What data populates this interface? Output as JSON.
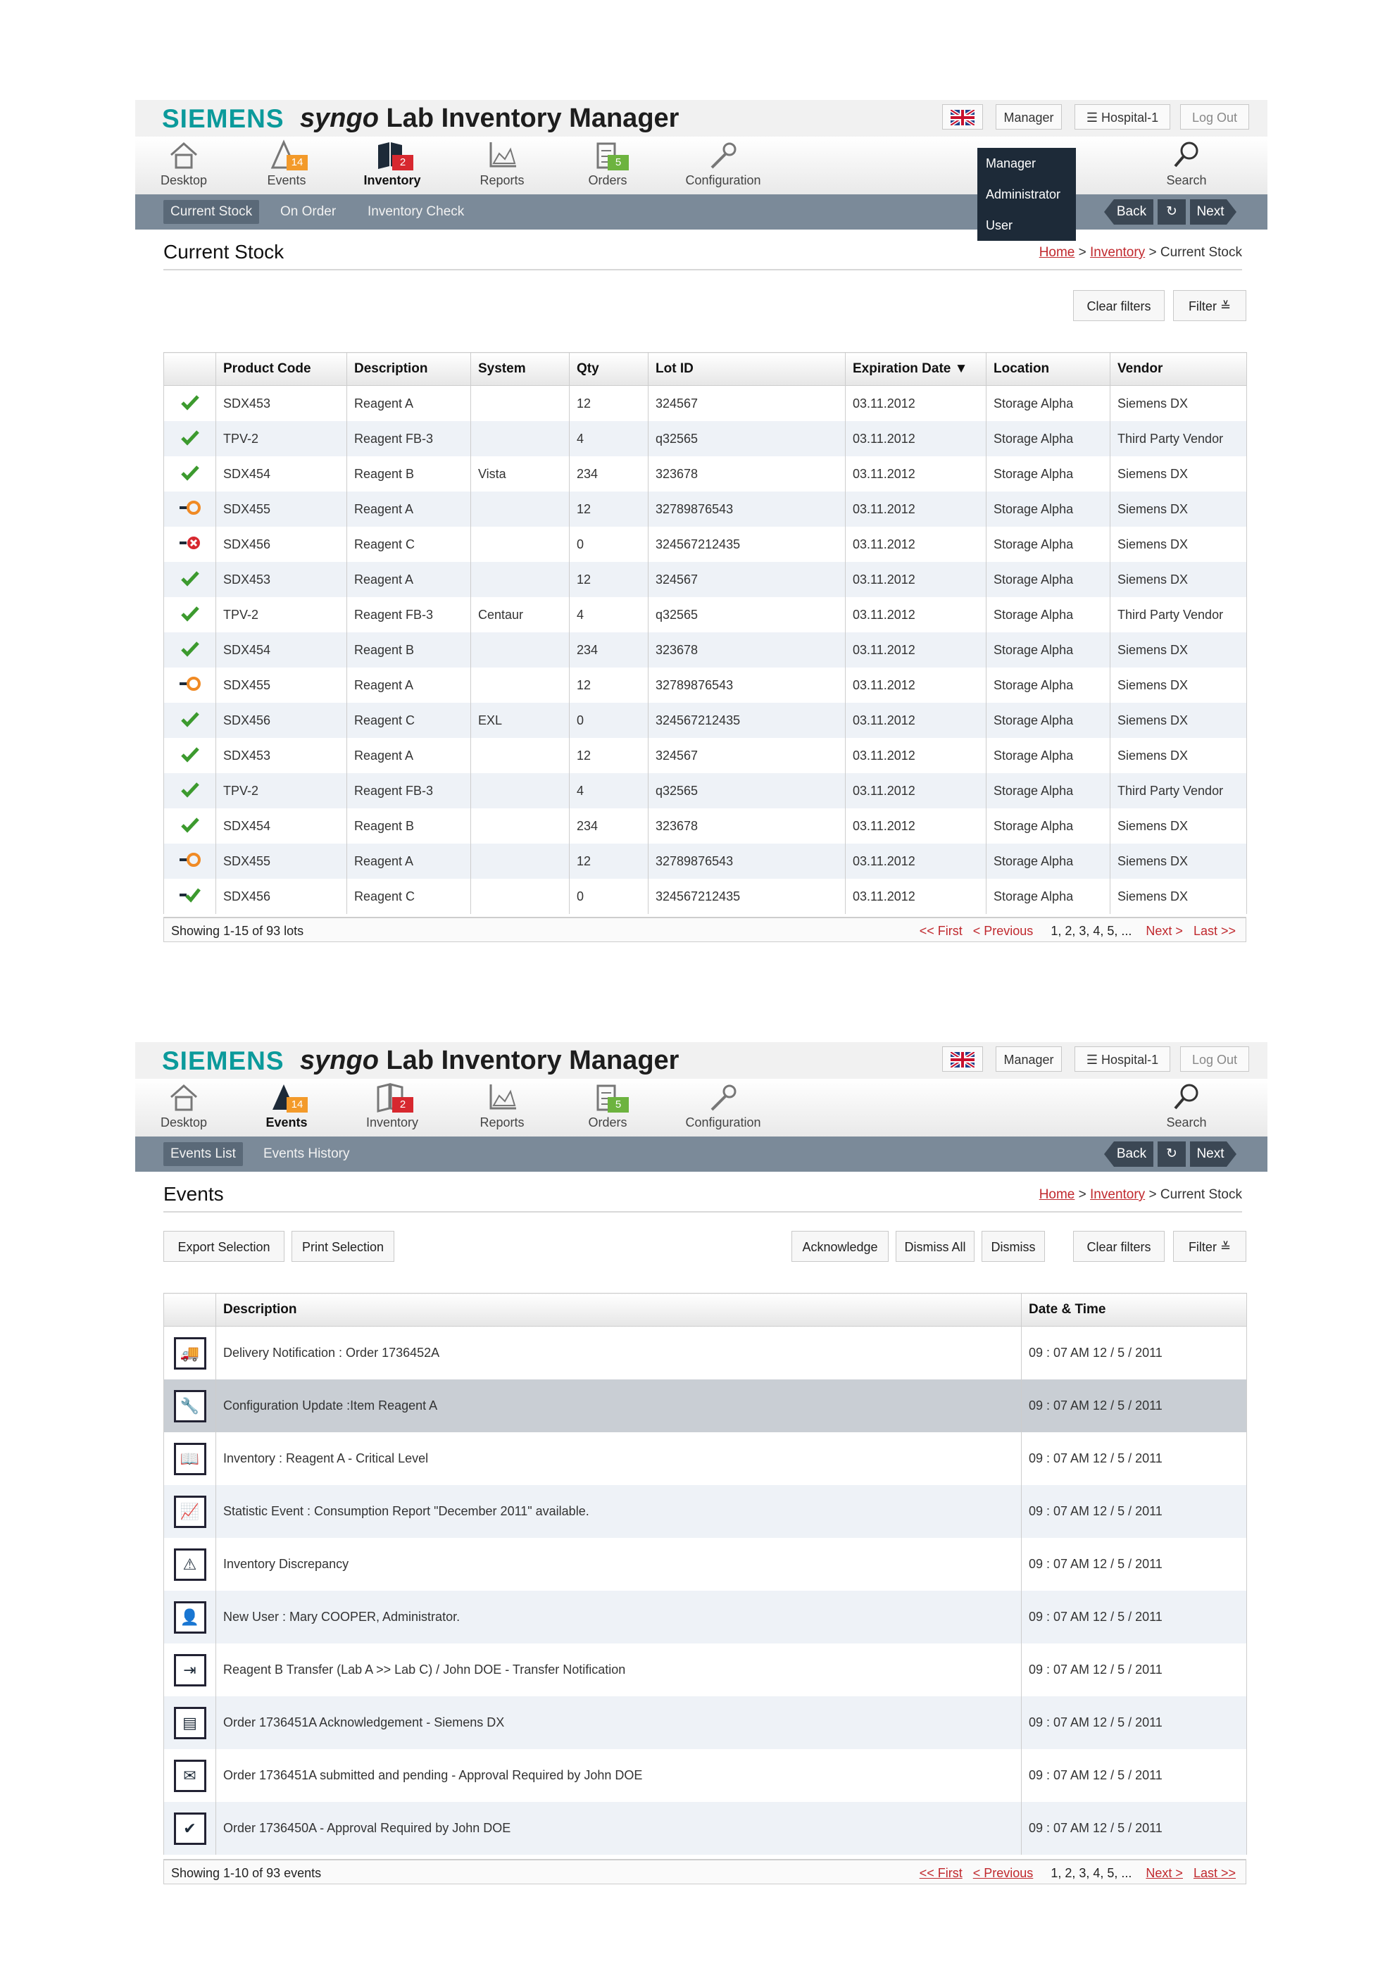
{
  "header": {
    "logo": "SIEMENS",
    "title_prefix": "syngo",
    "title_rest": "Lab Inventory Manager",
    "role_button": "Manager",
    "hospital_button": "Hospital-1",
    "logout_button": "Log Out"
  },
  "nav": {
    "desktop": "Desktop",
    "events": "Events",
    "events_badge": "14",
    "inventory": "Inventory",
    "inventory_badge": "2",
    "reports": "Reports",
    "orders": "Orders",
    "orders_badge": "5",
    "configuration": "Configuration",
    "search": "Search"
  },
  "nav_buttons": {
    "back": "Back",
    "next": "Next"
  },
  "stock_screen": {
    "subtabs": [
      "Current Stock",
      "On Order",
      "Inventory Check"
    ],
    "role_dropdown": [
      "Manager",
      "Administrator",
      "User"
    ],
    "page_title": "Current Stock",
    "breadcrumb": {
      "home": "Home",
      "sep1": " > ",
      "inventory": "Inventory",
      "sep2": " > ",
      "current": "Current Stock"
    },
    "clear_filters": "Clear filters",
    "filter": "Filter",
    "columns": [
      "Product Code",
      "Description",
      "System",
      "Qty",
      "Lot ID",
      "Expiration Date ▼",
      "Location",
      "Vendor"
    ],
    "rows": [
      {
        "status": "ok",
        "code": "SDX453",
        "desc": "Reagent A",
        "system": "",
        "qty": "12",
        "lot": "324567",
        "exp": "03.11.2012",
        "loc": "Storage Alpha",
        "vendor": "Siemens DX"
      },
      {
        "status": "ok",
        "code": "TPV-2",
        "desc": "Reagent FB-3",
        "system": "",
        "qty": "4",
        "lot": "q32565",
        "exp": "03.11.2012",
        "loc": "Storage Alpha",
        "vendor": "Third Party Vendor"
      },
      {
        "status": "ok",
        "code": "SDX454",
        "desc": "Reagent B",
        "system": "Vista",
        "qty": "234",
        "lot": "323678",
        "exp": "03.11.2012",
        "loc": "Storage Alpha",
        "vendor": "Siemens DX"
      },
      {
        "status": "transfer",
        "code": "SDX455",
        "desc": "Reagent A",
        "system": "",
        "qty": "12",
        "lot": "32789876543",
        "exp": "03.11.2012",
        "loc": "Storage Alpha",
        "vendor": "Siemens DX"
      },
      {
        "status": "error",
        "code": "SDX456",
        "desc": "Reagent C",
        "system": "",
        "qty": "0",
        "lot": "324567212435",
        "exp": "03.11.2012",
        "loc": "Storage Alpha",
        "vendor": "Siemens DX"
      },
      {
        "status": "ok",
        "code": "SDX453",
        "desc": "Reagent A",
        "system": "",
        "qty": "12",
        "lot": "324567",
        "exp": "03.11.2012",
        "loc": "Storage Alpha",
        "vendor": "Siemens DX"
      },
      {
        "status": "ok",
        "code": "TPV-2",
        "desc": "Reagent FB-3",
        "system": "Centaur",
        "qty": "4",
        "lot": "q32565",
        "exp": "03.11.2012",
        "loc": "Storage Alpha",
        "vendor": "Third Party Vendor"
      },
      {
        "status": "ok",
        "code": "SDX454",
        "desc": "Reagent B",
        "system": "",
        "qty": "234",
        "lot": "323678",
        "exp": "03.11.2012",
        "loc": "Storage Alpha",
        "vendor": "Siemens DX"
      },
      {
        "status": "transfer",
        "code": "SDX455",
        "desc": "Reagent A",
        "system": "",
        "qty": "12",
        "lot": "32789876543",
        "exp": "03.11.2012",
        "loc": "Storage Alpha",
        "vendor": "Siemens DX"
      },
      {
        "status": "ok",
        "code": "SDX456",
        "desc": "Reagent C",
        "system": "EXL",
        "qty": "0",
        "lot": "324567212435",
        "exp": "03.11.2012",
        "loc": "Storage Alpha",
        "vendor": "Siemens DX"
      },
      {
        "status": "ok",
        "code": "SDX453",
        "desc": "Reagent A",
        "system": "",
        "qty": "12",
        "lot": "324567",
        "exp": "03.11.2012",
        "loc": "Storage Alpha",
        "vendor": "Siemens DX"
      },
      {
        "status": "ok",
        "code": "TPV-2",
        "desc": "Reagent FB-3",
        "system": "",
        "qty": "4",
        "lot": "q32565",
        "exp": "03.11.2012",
        "loc": "Storage Alpha",
        "vendor": "Third Party Vendor"
      },
      {
        "status": "ok",
        "code": "SDX454",
        "desc": "Reagent B",
        "system": "",
        "qty": "234",
        "lot": "323678",
        "exp": "03.11.2012",
        "loc": "Storage Alpha",
        "vendor": "Siemens DX"
      },
      {
        "status": "transfer",
        "code": "SDX455",
        "desc": "Reagent A",
        "system": "",
        "qty": "12",
        "lot": "32789876543",
        "exp": "03.11.2012",
        "loc": "Storage Alpha",
        "vendor": "Siemens DX"
      },
      {
        "status": "received",
        "code": "SDX456",
        "desc": "Reagent C",
        "system": "",
        "qty": "0",
        "lot": "324567212435",
        "exp": "03.11.2012",
        "loc": "Storage Alpha",
        "vendor": "Siemens DX"
      }
    ],
    "footer_text": "Showing 1-15 of 93 lots",
    "pager": {
      "first": "<< First",
      "prev": "< Previous",
      "pages": "1, 2, 3, 4, 5, ...",
      "next": "Next >",
      "last": "Last >>"
    }
  },
  "events_screen": {
    "subtabs": [
      "Events List",
      "Events History"
    ],
    "page_title": "Events",
    "breadcrumb": {
      "home": "Home",
      "sep1": " > ",
      "inventory": "Inventory",
      "sep2": " > ",
      "current": "Current Stock"
    },
    "buttons": {
      "export": "Export Selection",
      "print": "Print Selection",
      "acknowledge": "Acknowledge",
      "dismiss_all": "Dismiss All",
      "dismiss": "Dismiss",
      "clear_filters": "Clear filters",
      "filter": "Filter"
    },
    "columns": [
      "Description",
      "Date & Time"
    ],
    "rows": [
      {
        "icon": "truck-icon",
        "desc": "Delivery Notification : Order 1736452A",
        "time": "09 : 07 AM 12 / 5 / 2011"
      },
      {
        "icon": "wrench-icon",
        "desc": "Configuration Update :Item Reagent A",
        "time": "09 : 07 AM 12 / 5 / 2011"
      },
      {
        "icon": "book-icon",
        "desc": "Inventory : Reagent A - Critical Level",
        "time": "09 : 07 AM 12 / 5 / 2011"
      },
      {
        "icon": "chart-icon",
        "desc": "Statistic Event : Consumption Report \"December 2011\" available.",
        "time": "09 : 07 AM 12 / 5 / 2011"
      },
      {
        "icon": "warning-icon",
        "desc": "Inventory Discrepancy",
        "time": "09 : 07 AM 12 / 5 / 2011"
      },
      {
        "icon": "user-icon",
        "desc": "New User : Mary COOPER, Administrator.",
        "time": "09 : 07 AM 12 / 5 / 2011"
      },
      {
        "icon": "transfer-icon",
        "desc": "Reagent B Transfer (Lab A >> Lab C) / John DOE - Transfer Notification",
        "time": "09 : 07 AM 12 / 5 / 2011"
      },
      {
        "icon": "order-icon",
        "desc": "Order 1736451A Acknowledgement - Siemens DX",
        "time": "09 : 07 AM 12 / 5 / 2011"
      },
      {
        "icon": "mail-icon",
        "desc": "Order 1736451A submitted and pending - Approval Required by John DOE",
        "time": "09 : 07 AM 12 / 5 / 2011"
      },
      {
        "icon": "check-icon",
        "desc": "Order  1736450A - Approval Required by John DOE",
        "time": "09 : 07 AM 12 / 5 / 2011"
      }
    ],
    "footer_text": "Showing 1-10 of 93 events",
    "pager": {
      "first": "<< First",
      "prev": "< Previous",
      "pages": "1, 2, 3, 4, 5, ...",
      "next": "Next >",
      "last": "Last >>"
    }
  },
  "colors": {
    "brand": "#0b9a9b",
    "link": "#c0282d",
    "subbar": "#7b8a99",
    "ok": "#3c9a2e",
    "warn": "#f08a24",
    "error": "#d7282f"
  }
}
